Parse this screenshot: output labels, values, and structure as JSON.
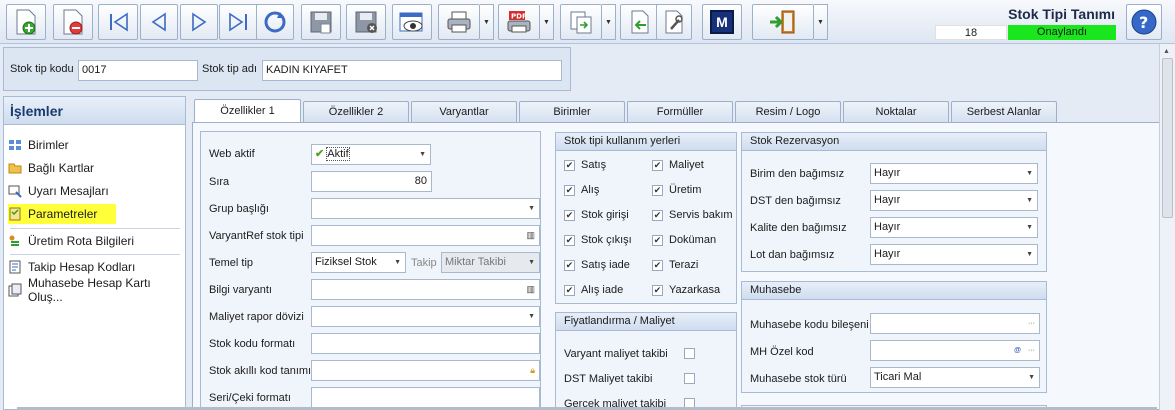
{
  "toolbar": {
    "buttons": [
      {
        "name": "new-icon"
      },
      {
        "name": "delete-icon"
      },
      {
        "name": "first-record-icon"
      },
      {
        "name": "prev-record-icon"
      },
      {
        "name": "next-record-icon"
      },
      {
        "name": "last-record-icon"
      },
      {
        "name": "refresh-icon"
      },
      {
        "name": "save-icon"
      },
      {
        "name": "save-cancel-icon"
      },
      {
        "name": "preview-icon"
      },
      {
        "name": "print-icon"
      },
      {
        "name": "pdf-export-icon"
      },
      {
        "name": "copy-icon"
      },
      {
        "name": "import-icon"
      },
      {
        "name": "tools-icon"
      },
      {
        "name": "m-icon"
      },
      {
        "name": "exit-icon"
      },
      {
        "name": "help-icon"
      }
    ],
    "m_label": "M"
  },
  "form": {
    "title": "Stok Tipi Tanımı",
    "record_count": "18",
    "status": "Onaylandı"
  },
  "header": {
    "code_label": "Stok tip kodu",
    "code_value": "0017",
    "name_label": "Stok tip adı",
    "name_value": "KADIN KIYAFET"
  },
  "left_panel": {
    "title": "İşlemler",
    "items": [
      {
        "label": "Birimler",
        "icon": "grid-icon"
      },
      {
        "label": "Bağlı Kartlar",
        "icon": "folder-icon"
      },
      {
        "label": "Uyarı Mesajları",
        "icon": "message-icon"
      },
      {
        "label": "Parametreler",
        "icon": "checklist-icon"
      },
      {
        "label": "Üretim Rota Bilgileri",
        "icon": "route-icon"
      },
      {
        "label": "Takip Hesap Kodları",
        "icon": "ledger-icon"
      },
      {
        "label": "Muhasebe Hesap Kartı Oluş...",
        "icon": "account-icon"
      }
    ]
  },
  "tabs": [
    "Özellikler 1",
    "Özellikler 2",
    "Varyantlar",
    "Birimler",
    "Formüller",
    "Resim / Logo",
    "Noktalar",
    "Serbest Alanlar"
  ],
  "props": {
    "web_label": "Web aktif",
    "web_value": "Aktif",
    "sira_label": "Sıra",
    "sira_value": "80",
    "grup_label": "Grup başlığı",
    "varyantref_label": "VaryantRef stok tipi",
    "temel_label": "Temel tip",
    "temel_value": "Fiziksel Stok",
    "takip_label": "Takip",
    "takip_value": "Miktar Takibi",
    "bilgi_label": "Bilgi varyantı",
    "maliyet_label": "Maliyet rapor dövizi",
    "stokformat_label": "Stok kodu formatı",
    "akilli_label": "Stok akıllı kod tanımı",
    "seri_label": "Seri/Çeki formatı"
  },
  "usage": {
    "title": "Stok tipi kullanım yerleri",
    "items": [
      {
        "label": "Satış",
        "checked": true
      },
      {
        "label": "Maliyet",
        "checked": true
      },
      {
        "label": "Alış",
        "checked": true
      },
      {
        "label": "Üretim",
        "checked": true
      },
      {
        "label": "Stok girişi",
        "checked": true
      },
      {
        "label": "Servis bakım",
        "checked": true
      },
      {
        "label": "Stok çıkışı",
        "checked": true
      },
      {
        "label": "Doküman",
        "checked": true
      },
      {
        "label": "Satış iade",
        "checked": true
      },
      {
        "label": "Terazi",
        "checked": true
      },
      {
        "label": "Alış iade",
        "checked": true
      },
      {
        "label": "Yazarkasa",
        "checked": true
      }
    ]
  },
  "pricing": {
    "title": "Fiyatlandırma / Maliyet",
    "items": [
      {
        "label": "Varyant maliyet takibi",
        "checked": false
      },
      {
        "label": "DST Maliyet takibi",
        "checked": false
      },
      {
        "label": "Gerçek maliyet takibi",
        "checked": false
      }
    ]
  },
  "reservation": {
    "title": "Stok Rezervasyon",
    "rows": [
      {
        "label": "Birim den bağımsız",
        "value": "Hayır"
      },
      {
        "label": "DST den bağımsız",
        "value": "Hayır"
      },
      {
        "label": "Kalite den bağımsız",
        "value": "Hayır"
      },
      {
        "label": "Lot dan bağımsız",
        "value": "Hayır"
      }
    ]
  },
  "accounting": {
    "title": "Muhasebe",
    "kod_label": "Muhasebe kodu bileşeni",
    "ozel_label": "MH Özel kod",
    "tur_label": "Muhasebe stok türü",
    "tur_value": "Ticari Mal",
    "ellipsis": "···"
  },
  "colors": {
    "status_bg": "#19e61c",
    "highlight": "#ffff3a",
    "accent": "#1b3a6e"
  }
}
